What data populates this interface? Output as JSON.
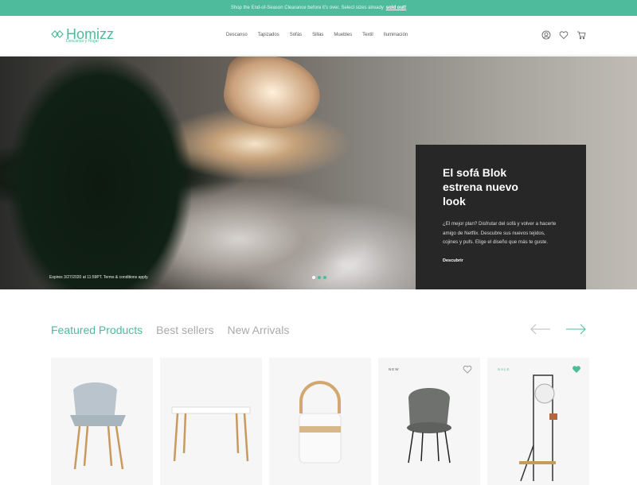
{
  "promo": {
    "text": "Shop the End-of-Season Clearance before it's over. Select sizes already",
    "link": "sold out!"
  },
  "header": {
    "logo_name": "Homizz",
    "logo_tagline": "Descanso y Hogar",
    "nav": [
      "Descanso",
      "Tapizados",
      "Sofás",
      "Sillas",
      "Muebles",
      "Textil",
      "Iluminación"
    ],
    "icons": [
      "user-icon",
      "heart-icon",
      "cart-icon"
    ]
  },
  "hero": {
    "title": "El sofá Blok estrena nuevo look",
    "text": "¿El mejor plan? Disfrutar del sofá y volver a hacerte amigo de Netflix. Descubre sus nuevos tejidos, cojines y pufs. Elige el diseño que más te guste.",
    "cta": "Descubrir",
    "expires": "Expires 3/27/2020 at 11:59PT. Terms & conditions apply.",
    "slides": 3,
    "active_slide": 1
  },
  "products": {
    "tabs": [
      "Featured Products",
      "Best sellers",
      "New Arrivals"
    ],
    "active_tab": 0,
    "cards": [
      {
        "badge": "",
        "favorite": false
      },
      {
        "badge": "",
        "favorite": false
      },
      {
        "badge": "",
        "favorite": false
      },
      {
        "badge": "NEW",
        "favorite": false
      },
      {
        "badge": "SALE",
        "favorite": true
      }
    ]
  },
  "colors": {
    "accent": "#4dbb9c",
    "hero_card": "#272727"
  }
}
